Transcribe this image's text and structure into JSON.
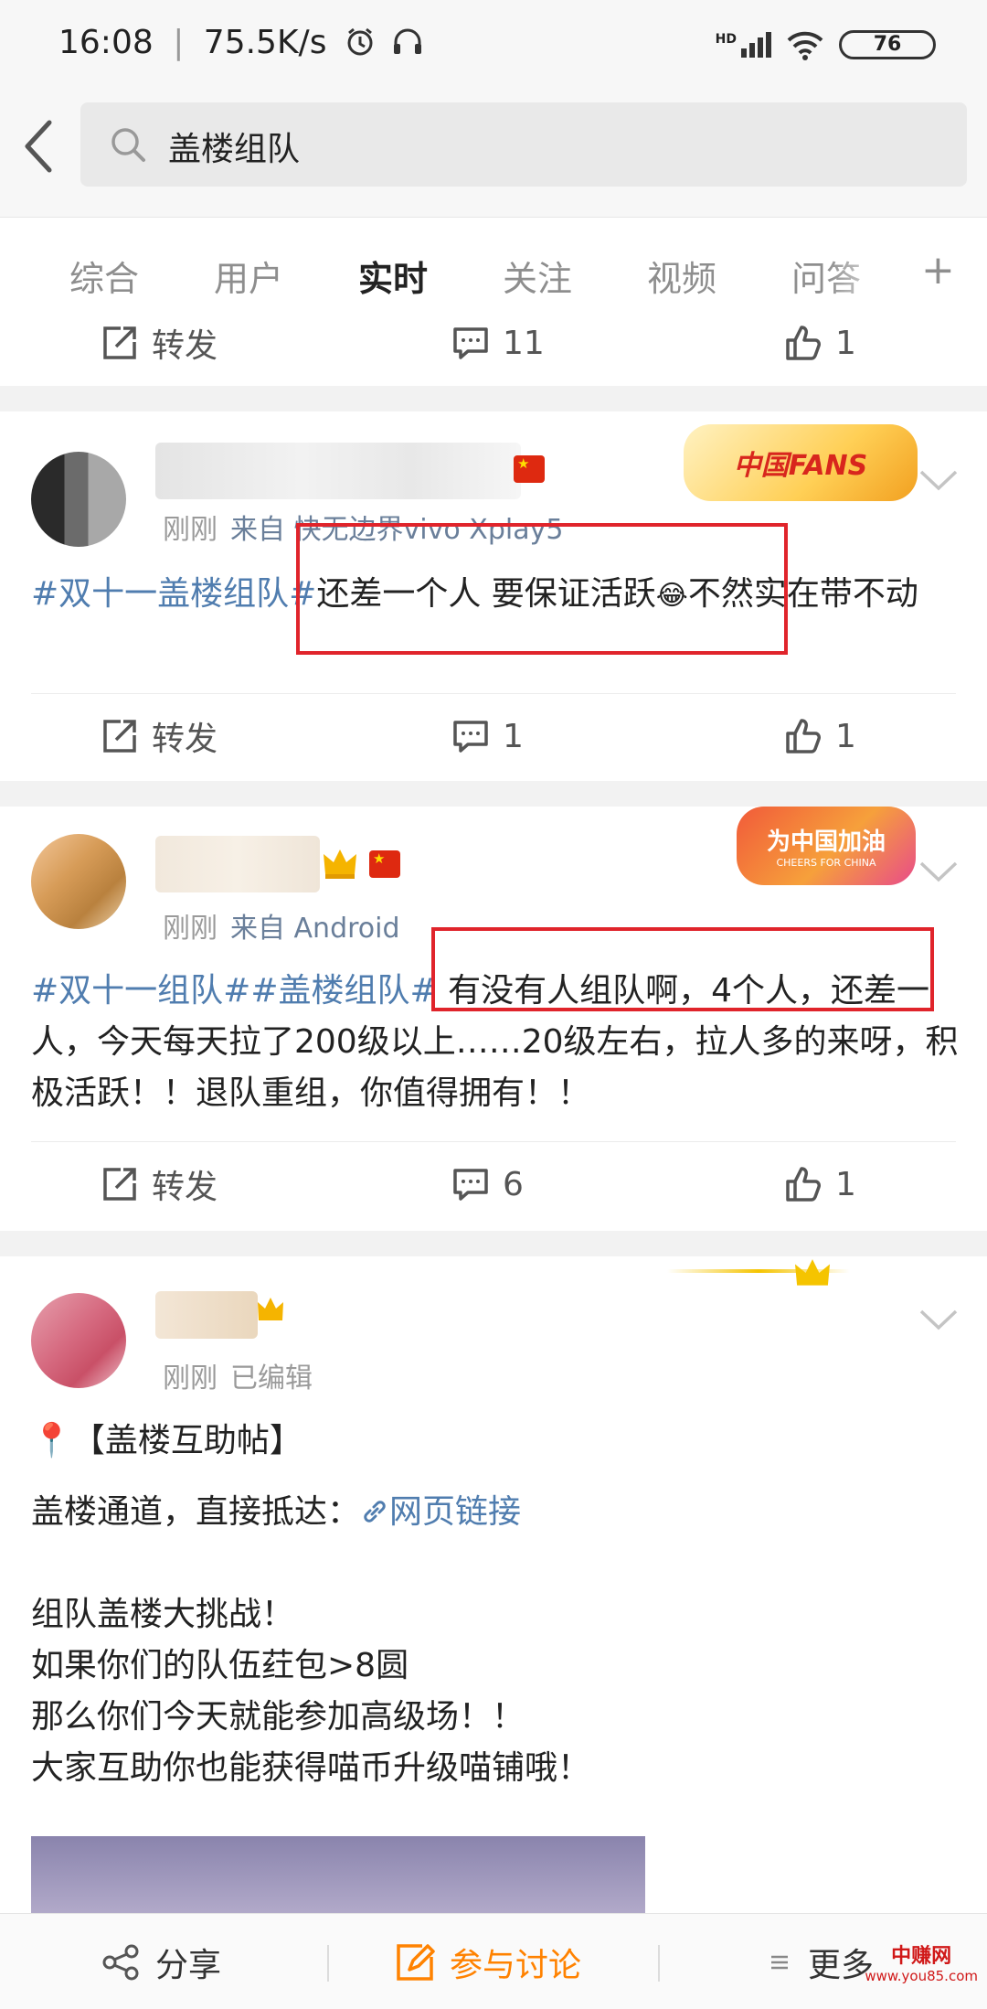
{
  "status_bar": {
    "time": "16:08",
    "speed": "75.5K/s",
    "network": "HD",
    "battery": "76"
  },
  "search": {
    "query": "盖楼组队"
  },
  "tabs": [
    {
      "label": "综合",
      "active": false
    },
    {
      "label": "用户",
      "active": false
    },
    {
      "label": "实时",
      "active": true
    },
    {
      "label": "关注",
      "active": false
    },
    {
      "label": "视频",
      "active": false
    },
    {
      "label": "问答",
      "active": false
    }
  ],
  "add_tab_label": "+",
  "top_actions": {
    "repost": "转发",
    "comments": "11",
    "likes": "1"
  },
  "posts": [
    {
      "time": "刚刚",
      "source": "来自 快无边界vivo Xplay5",
      "badge": "中国FANS",
      "topic": "#双十一盖楼组队#",
      "text": "还差一个人  要保证活跃",
      "emoji": "😂",
      "text_after": "不然实在带不动",
      "repost": "转发",
      "comments": "1",
      "likes": "1"
    },
    {
      "time": "刚刚",
      "source": "来自 Android",
      "badge": "为中国加油",
      "badge_sub": "CHEERS FOR CHINA",
      "topic1": "#双十一组队#",
      "topic2": "#盖楼组队#",
      "text": " 有没有人组队啊，4个人，还差一人，今天每天拉了200级以上……20级左右，拉人多的来呀，积极活跃！！退队重组，你值得拥有！！",
      "repost": "转发",
      "comments": "6",
      "likes": "1"
    },
    {
      "time": "刚刚",
      "source": "已编辑",
      "title": "【盖楼互助帖】",
      "line_channel": "盖楼通道，直接抵达：",
      "link": "网页链接",
      "line1": "组队盖楼大挑战！",
      "line2": "如果你们的队伍荭包>8圆",
      "line3": "那么你们今天就能参加高级场！！",
      "line4": "大家互助你也能获得喵币升级喵铺哦！"
    }
  ],
  "bottom_bar": {
    "share": "分享",
    "discuss": "参与讨论",
    "more": "更多"
  },
  "watermark": {
    "text": "中赚网",
    "url": "www.you85.com"
  },
  "colors": {
    "accent": "#ff8200",
    "topic": "#507daf",
    "highlight": "#e0242b"
  }
}
